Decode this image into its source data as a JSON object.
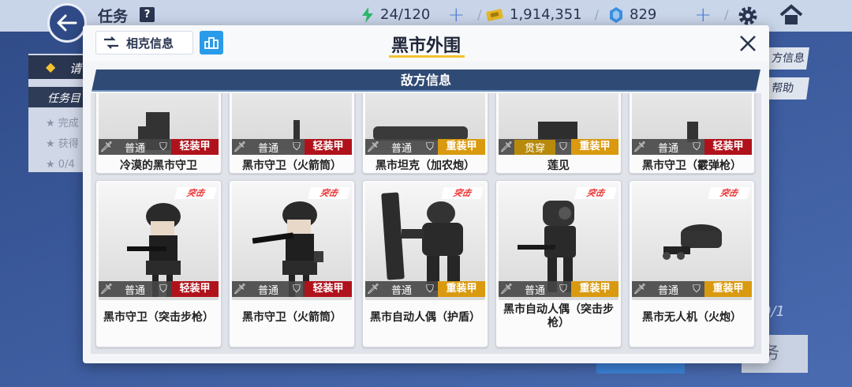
{
  "topbar": {
    "title": "任务",
    "help": "?",
    "energy": "24/120",
    "coins": "1,914,351",
    "gems": "829"
  },
  "background": {
    "side_warning": "请",
    "side_task": "任务目",
    "side_items": [
      "完成",
      "获得",
      "0/4"
    ],
    "right_buttons": [
      "方信息",
      "帮助"
    ],
    "progress": "0/1",
    "bottom_button": "务"
  },
  "modal": {
    "counter_info": "相克信息",
    "title": "黑市外围",
    "section_title": "敌方信息"
  },
  "enemies_row1": [
    {
      "name": "冷漠的黑市守卫",
      "type": "普通",
      "armor": "轻装甲",
      "armor_kind": "light",
      "type_kind": "normal"
    },
    {
      "name": "黑市守卫（火箭筒）",
      "type": "普通",
      "armor": "轻装甲",
      "armor_kind": "light",
      "type_kind": "normal"
    },
    {
      "name": "黑市坦克（加农炮）",
      "type": "普通",
      "armor": "重装甲",
      "armor_kind": "heavy",
      "type_kind": "normal"
    },
    {
      "name": "莲见",
      "type": "贯穿",
      "armor": "重装甲",
      "armor_kind": "heavy",
      "type_kind": "pierce"
    },
    {
      "name": "黑市守卫（霰弹枪）",
      "type": "普通",
      "armor": "轻装甲",
      "armor_kind": "light",
      "type_kind": "normal"
    }
  ],
  "enemies_row2": [
    {
      "name": "黑市守卫（突击步枪）",
      "tag": "突击",
      "type": "普通",
      "armor": "轻装甲",
      "armor_kind": "light",
      "type_kind": "normal"
    },
    {
      "name": "黑市守卫（火箭筒）",
      "tag": "突击",
      "type": "普通",
      "armor": "轻装甲",
      "armor_kind": "light",
      "type_kind": "normal"
    },
    {
      "name": "黑市自动人偶（护盾）",
      "tag": "突击",
      "type": "普通",
      "armor": "重装甲",
      "armor_kind": "heavy",
      "type_kind": "normal"
    },
    {
      "name": "黑市自动人偶（突击步枪）",
      "tag": "突击",
      "type": "普通",
      "armor": "重装甲",
      "armor_kind": "heavy",
      "type_kind": "normal"
    },
    {
      "name": "黑市无人机（火炮）",
      "tag": "突击",
      "type": "普通",
      "armor": "重装甲",
      "armor_kind": "heavy",
      "type_kind": "normal"
    }
  ],
  "colors": {
    "light_armor": "#b0121c",
    "heavy_armor": "#d99a10",
    "pierce": "#b88a0c",
    "accent": "#2a9be8",
    "title_underline": "#f2c230"
  },
  "icons": [
    "back-arrow-icon",
    "help-icon",
    "energy-bolt-icon",
    "ticket-icon",
    "gem-icon",
    "gear-icon",
    "home-icon",
    "counter-info-icon",
    "map-icon",
    "close-icon",
    "sword-icon",
    "shield-icon"
  ]
}
